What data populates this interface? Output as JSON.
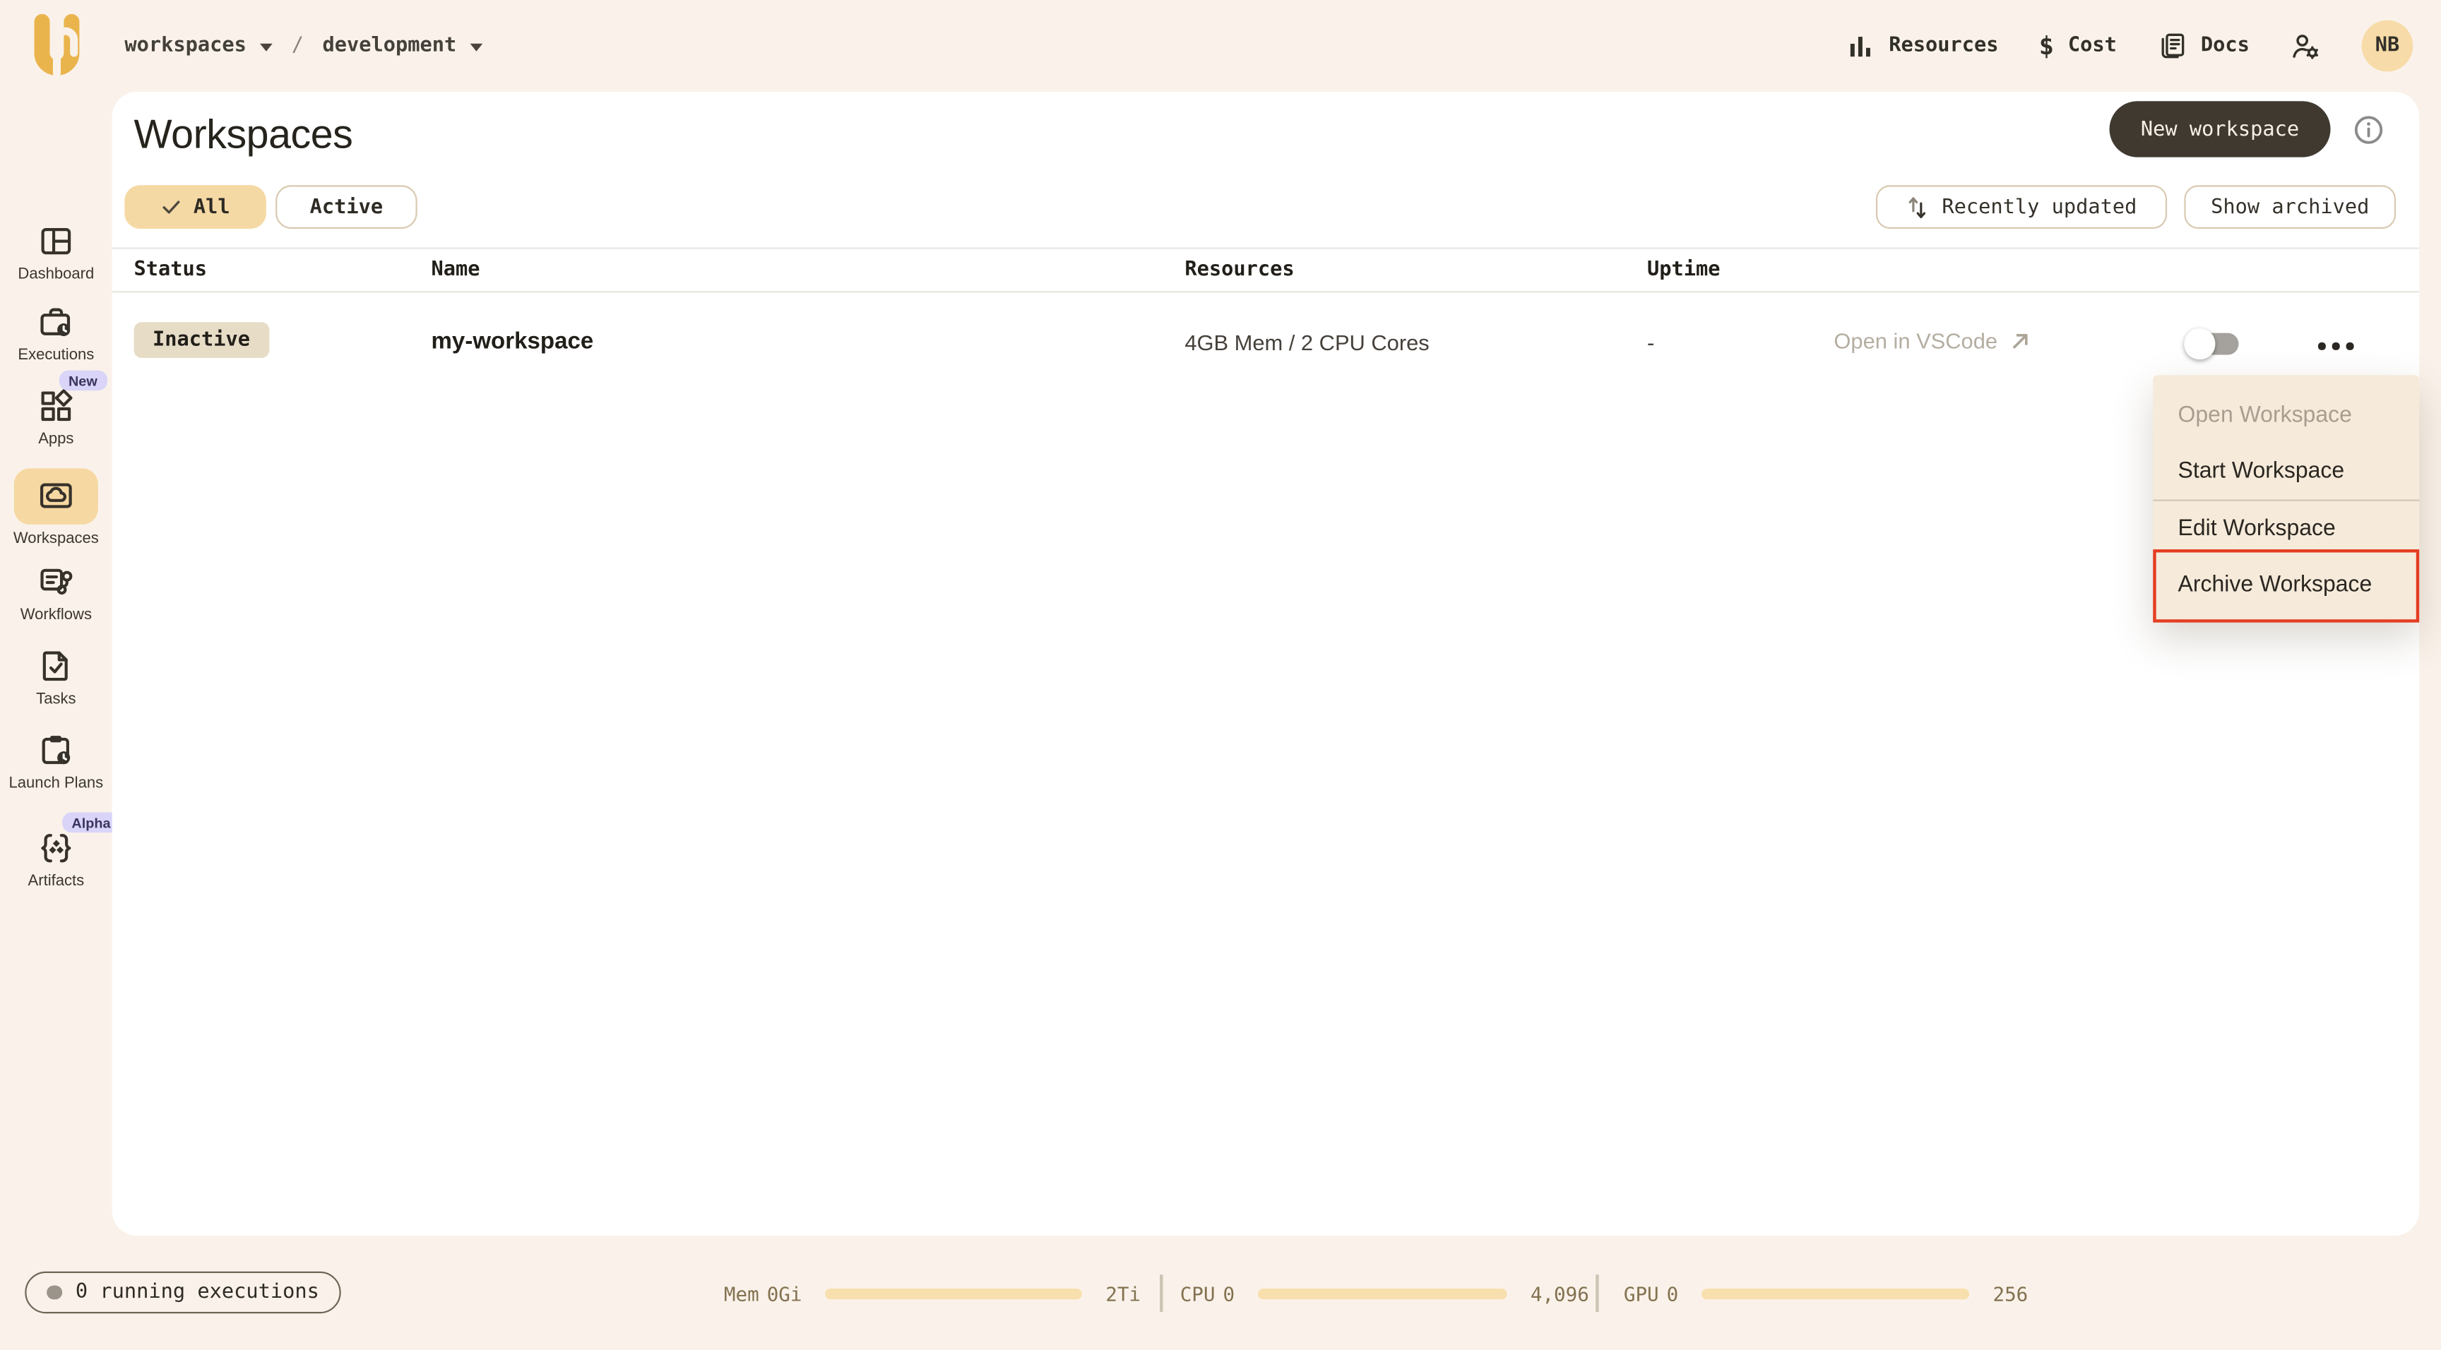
{
  "topbar": {
    "breadcrumb": [
      {
        "label": "workspaces"
      },
      {
        "label": "development"
      }
    ],
    "breadcrumb_separator": "/",
    "nav": {
      "resources": "Resources",
      "cost_icon": "$",
      "cost": "Cost",
      "docs": "Docs"
    },
    "avatar_initials": "NB"
  },
  "sidebar": {
    "items": [
      {
        "label": "Dashboard"
      },
      {
        "label": "Executions"
      },
      {
        "label": "Apps",
        "badge": "New"
      },
      {
        "label": "Workspaces",
        "active": true
      },
      {
        "label": "Workflows"
      },
      {
        "label": "Tasks"
      },
      {
        "label": "Launch Plans"
      },
      {
        "label": "Artifacts",
        "badge": "Alpha"
      }
    ]
  },
  "main": {
    "title": "Workspaces",
    "new_workspace_button": "New workspace",
    "filters": {
      "all": "All",
      "active": "Active"
    },
    "sort_button": "Recently updated",
    "archived_button": "Show archived",
    "table": {
      "columns": [
        "Status",
        "Name",
        "Resources",
        "Uptime"
      ],
      "rows": [
        {
          "status": "Inactive",
          "name": "my-workspace",
          "resources": "4GB Mem / 2 CPU Cores",
          "uptime": "-",
          "open_link": "Open in VSCode"
        }
      ]
    },
    "context_menu": {
      "items": [
        {
          "label": "Open Workspace",
          "disabled": true
        },
        {
          "label": "Start Workspace"
        },
        {
          "label": "Edit Workspace"
        },
        {
          "label": "Archive Workspace",
          "highlighted": true
        }
      ]
    }
  },
  "statusbar": {
    "executions": "0 running executions",
    "meters": [
      {
        "label": "Mem",
        "used": "0Gi",
        "max": "2Ti"
      },
      {
        "label": "CPU",
        "used": "0",
        "max": "4,096"
      },
      {
        "label": "GPU",
        "used": "0",
        "max": "256"
      }
    ]
  },
  "colors": {
    "background_cream": "#faf2ea",
    "panel_white": "#ffffff",
    "accent_gold": "#eab44d",
    "active_item_bg": "#f6d8a2",
    "dark_button": "#3f3930",
    "menu_bg": "#f6ebdb",
    "highlight_red": "#e43d22",
    "badge_purple": "#d9d4f8",
    "inactive_badge": "#e7ddc7",
    "meter_fill": "#f8dfae",
    "muted_brown": "#837250",
    "disabled_gray": "#a89e90"
  }
}
